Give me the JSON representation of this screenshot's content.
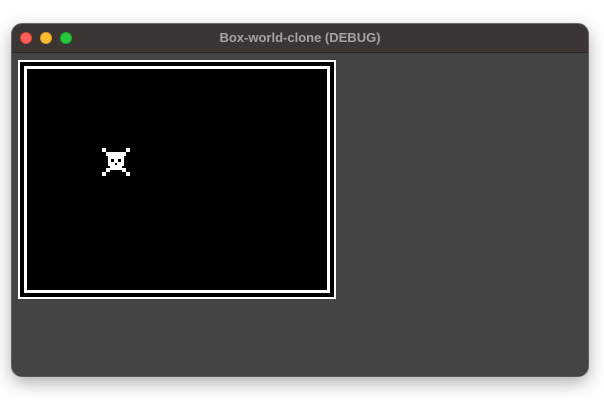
{
  "window": {
    "title": "Box-world-clone (DEBUG)"
  },
  "titlebar": {
    "buttons": [
      "close-button",
      "minimize-button",
      "zoom-button"
    ]
  },
  "game": {
    "background_color": "#000000",
    "border_color": "#ffffff",
    "window_background_color": "#444444",
    "sprite": "skull-crossbones-icon"
  }
}
